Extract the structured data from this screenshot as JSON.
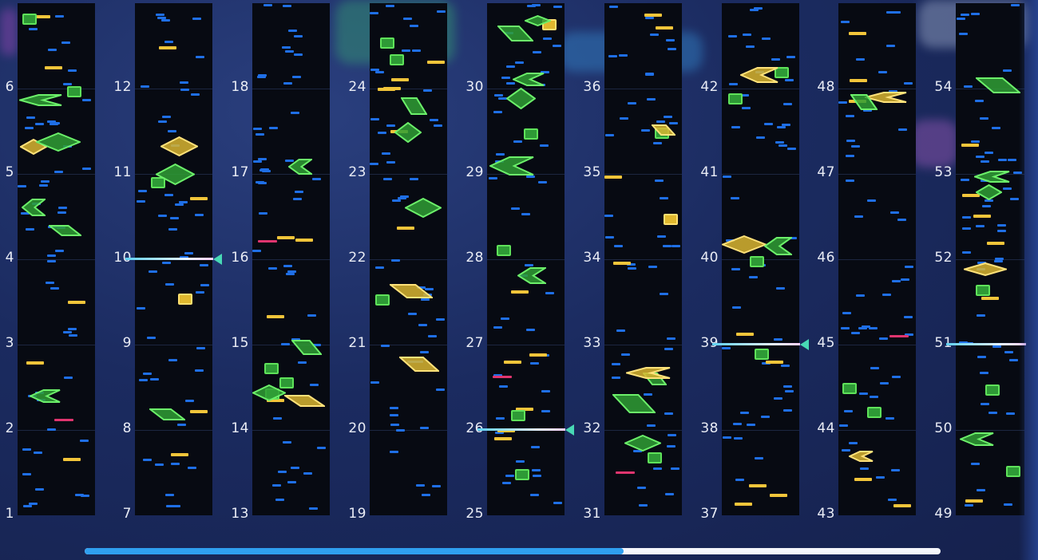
{
  "chart": {
    "bars_per_column": 6,
    "columns": [
      {
        "index": 0,
        "labels": [
          "1",
          "2",
          "3",
          "4",
          "5",
          "6"
        ]
      },
      {
        "index": 1,
        "labels": [
          "7",
          "8",
          "9",
          "10",
          "11",
          "12"
        ]
      },
      {
        "index": 2,
        "labels": [
          "13",
          "14",
          "15",
          "16",
          "17",
          "18"
        ]
      },
      {
        "index": 3,
        "labels": [
          "19",
          "20",
          "21",
          "22",
          "23",
          "24"
        ]
      },
      {
        "index": 4,
        "labels": [
          "25",
          "26",
          "27",
          "28",
          "29",
          "30"
        ]
      },
      {
        "index": 5,
        "labels": [
          "31",
          "32",
          "33",
          "34",
          "35",
          "36"
        ]
      },
      {
        "index": 6,
        "labels": [
          "37",
          "38",
          "39",
          "40",
          "41",
          "42"
        ]
      },
      {
        "index": 7,
        "labels": [
          "43",
          "44",
          "45",
          "46",
          "47",
          "48"
        ]
      },
      {
        "index": 8,
        "labels": [
          "49",
          "50",
          "51",
          "52",
          "53",
          "54"
        ]
      }
    ],
    "markers": [
      {
        "column": 1,
        "bar": "10"
      },
      {
        "column": 4,
        "bar": "26"
      },
      {
        "column": 6,
        "bar": "39"
      },
      {
        "column": 8,
        "bar": "51"
      }
    ]
  },
  "scrollbar": {
    "progress": 0.63
  },
  "colors": {
    "tap_note": "#1f6fe6",
    "hold_note": "#f2c53a",
    "flick_note": "#e0356f",
    "slide_note": "#3fbf3c",
    "marker": "#48d9b5",
    "scroll_fill": "#2f9ff0",
    "scroll_track": "#f4f6fb"
  },
  "icons": {
    "marker": "triangle-marker-icon"
  }
}
